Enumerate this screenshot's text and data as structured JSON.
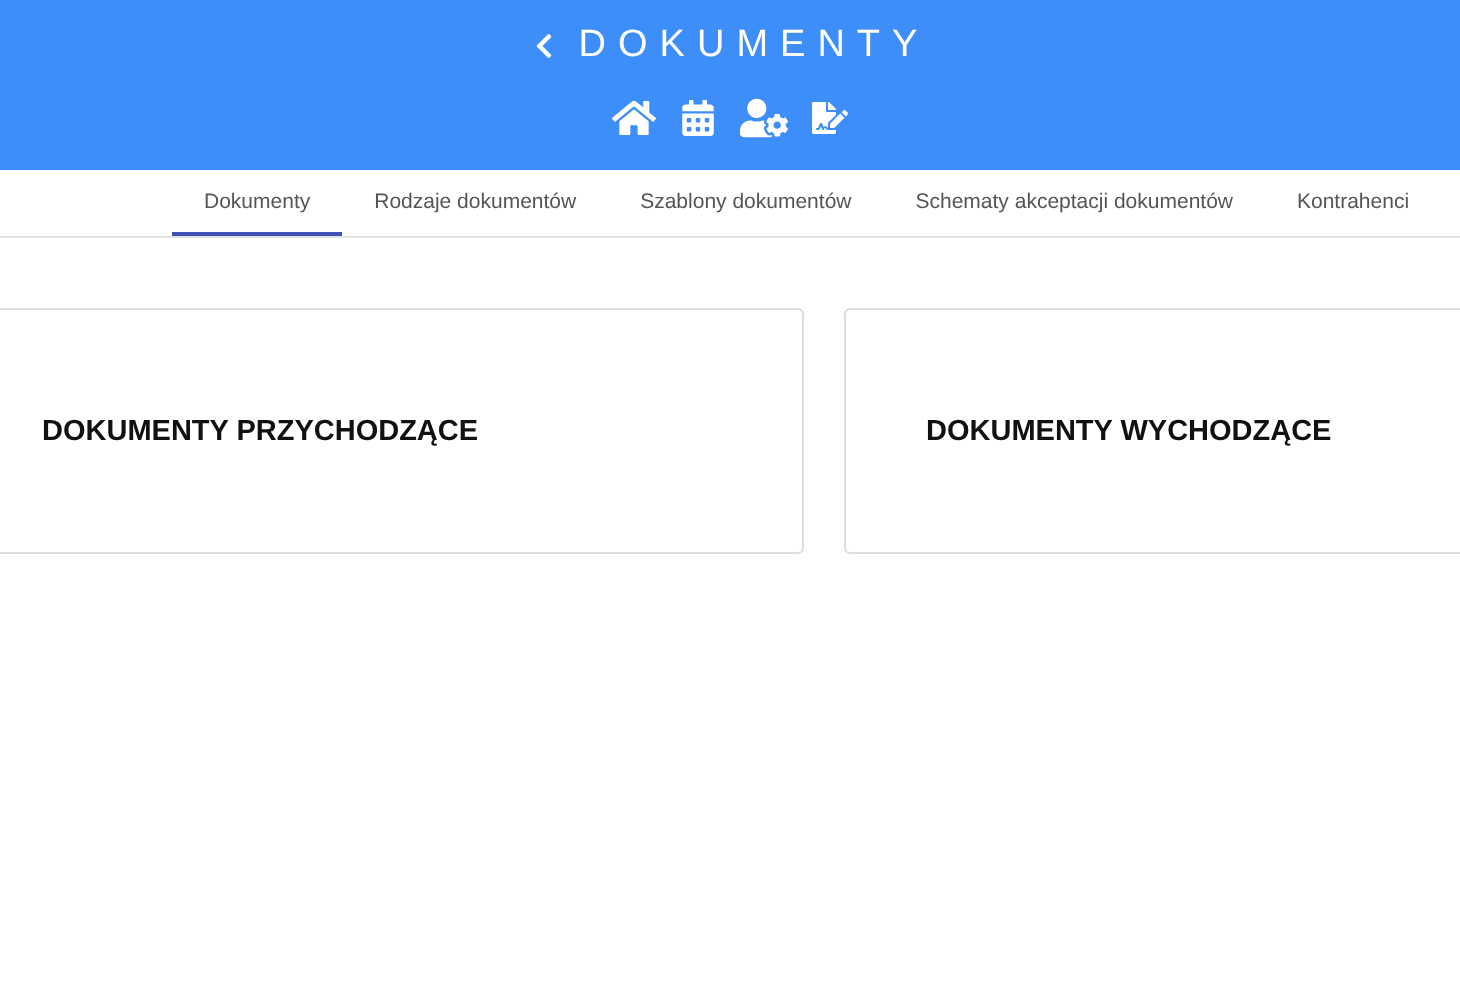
{
  "header": {
    "title": "DOKUMENTY"
  },
  "tabs": [
    {
      "label": "Dokumenty",
      "selected": true
    },
    {
      "label": "Rodzaje dokumentów",
      "selected": false
    },
    {
      "label": "Szablony dokumentów",
      "selected": false
    },
    {
      "label": "Schematy akceptacji dokumentów",
      "selected": false
    },
    {
      "label": "Kontrahenci",
      "selected": false
    }
  ],
  "cards": [
    {
      "title": "DOKUMENTY PRZYCHODZĄCE"
    },
    {
      "title": "DOKUMENTY WYCHODZĄCE"
    }
  ]
}
